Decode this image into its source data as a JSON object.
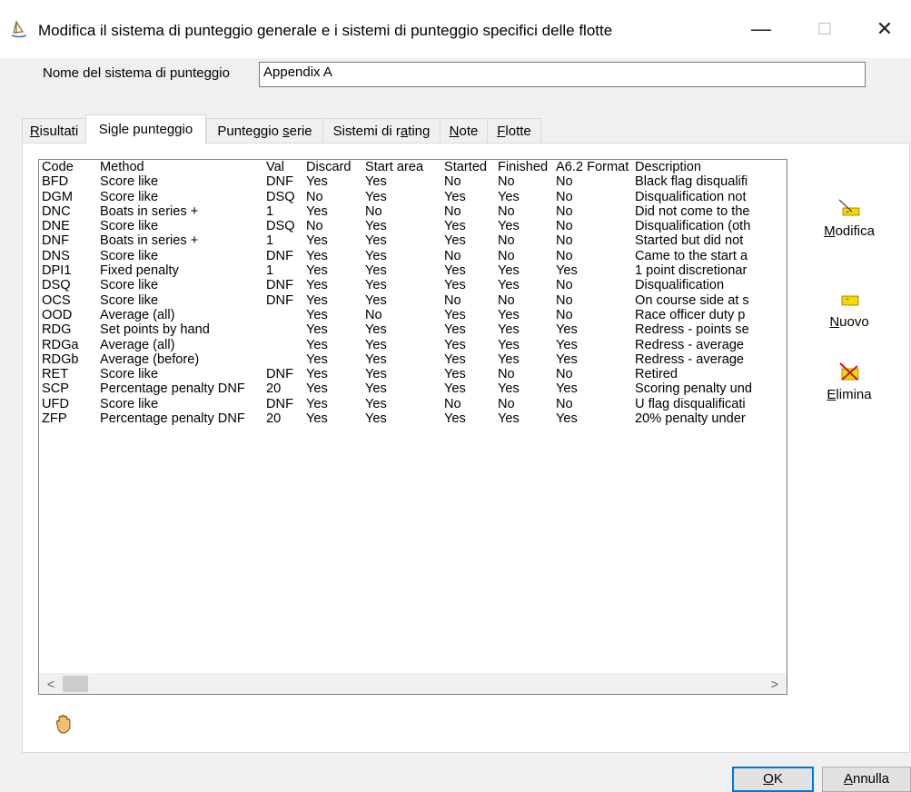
{
  "window": {
    "title": "Modifica il sistema di punteggio generale e i sistemi di punteggio specifici delle flotte",
    "minimize_glyph": "—",
    "maximize_glyph": "☐",
    "close_glyph": "✕"
  },
  "form": {
    "name_label": "Nome del sistema di punteggio",
    "name_value": "Appendix A"
  },
  "tabs": [
    {
      "pre": "",
      "key": "R",
      "post": "isultati"
    },
    {
      "pre": "Sigle punteggio",
      "key": "",
      "post": ""
    },
    {
      "pre": "Punteggio ",
      "key": "s",
      "post": "erie"
    },
    {
      "pre": "Sistemi di r",
      "key": "a",
      "post": "ting"
    },
    {
      "pre": "",
      "key": "N",
      "post": "ote"
    },
    {
      "pre": "",
      "key": "F",
      "post": "lotte"
    }
  ],
  "table": {
    "headers": [
      "Code",
      "Method",
      "Val",
      "Discard",
      "Start area",
      "Started",
      "Finished",
      "A6.2 Format",
      "Description"
    ],
    "rows": [
      [
        "BFD",
        "Score like",
        "DNF",
        "Yes",
        "Yes",
        "No",
        "No",
        "No",
        "Black flag disqualifi"
      ],
      [
        "DGM",
        "Score like",
        "DSQ",
        "No",
        "Yes",
        "Yes",
        "Yes",
        "No",
        "Disqualification not"
      ],
      [
        "DNC",
        "Boats in series +",
        "1",
        "Yes",
        "No",
        "No",
        "No",
        "No",
        "Did not come to the"
      ],
      [
        "DNE",
        "Score like",
        "DSQ",
        "No",
        "Yes",
        "Yes",
        "Yes",
        "No",
        "Disqualification (oth"
      ],
      [
        "DNF",
        "Boats in series +",
        "1",
        "Yes",
        "Yes",
        "Yes",
        "No",
        "No",
        "Started but did not"
      ],
      [
        "DNS",
        "Score like",
        "DNF",
        "Yes",
        "Yes",
        "No",
        "No",
        "No",
        "Came to the start a"
      ],
      [
        "DPI1",
        "Fixed penalty",
        "1",
        "Yes",
        "Yes",
        "Yes",
        "Yes",
        "Yes",
        "1 point discretionar"
      ],
      [
        "DSQ",
        "Score like",
        "DNF",
        "Yes",
        "Yes",
        "Yes",
        "Yes",
        "No",
        "Disqualification"
      ],
      [
        "OCS",
        "Score like",
        "DNF",
        "Yes",
        "Yes",
        "No",
        "No",
        "No",
        "On course side at s"
      ],
      [
        "OOD",
        "Average (all)",
        "",
        "Yes",
        "No",
        "Yes",
        "Yes",
        "No",
        "Race officer duty p"
      ],
      [
        "RDG",
        "Set points by hand",
        "",
        "Yes",
        "Yes",
        "Yes",
        "Yes",
        "Yes",
        "Redress - points se"
      ],
      [
        "RDGa",
        "Average (all)",
        "",
        "Yes",
        "Yes",
        "Yes",
        "Yes",
        "Yes",
        "Redress - average"
      ],
      [
        "RDGb",
        "Average (before)",
        "",
        "Yes",
        "Yes",
        "Yes",
        "Yes",
        "Yes",
        "Redress - average"
      ],
      [
        "RET",
        "Score like",
        "DNF",
        "Yes",
        "Yes",
        "Yes",
        "No",
        "No",
        "Retired"
      ],
      [
        "SCP",
        "Percentage penalty DNF",
        "20",
        "Yes",
        "Yes",
        "Yes",
        "Yes",
        "Yes",
        "Scoring penalty und"
      ],
      [
        "UFD",
        "Score like",
        "DNF",
        "Yes",
        "Yes",
        "No",
        "No",
        "No",
        "U flag disqualificati"
      ],
      [
        "ZFP",
        "Percentage penalty DNF",
        "20",
        "Yes",
        "Yes",
        "Yes",
        "Yes",
        "Yes",
        "20% penalty under"
      ]
    ],
    "scroll_left": "<",
    "scroll_right": ">"
  },
  "side_buttons": {
    "edit": {
      "key": "M",
      "post": "odifica"
    },
    "new": {
      "key": "N",
      "post": "uovo"
    },
    "delete": {
      "key": "E",
      "post": "limina"
    }
  },
  "footer": {
    "ok": {
      "key": "O",
      "post": "K"
    },
    "cancel": {
      "key": "A",
      "post": "nnulla"
    }
  },
  "colors": {
    "accent": "#0078d7",
    "icon_yellow": "#f5d800",
    "delete_red": "#cc1a1a"
  }
}
